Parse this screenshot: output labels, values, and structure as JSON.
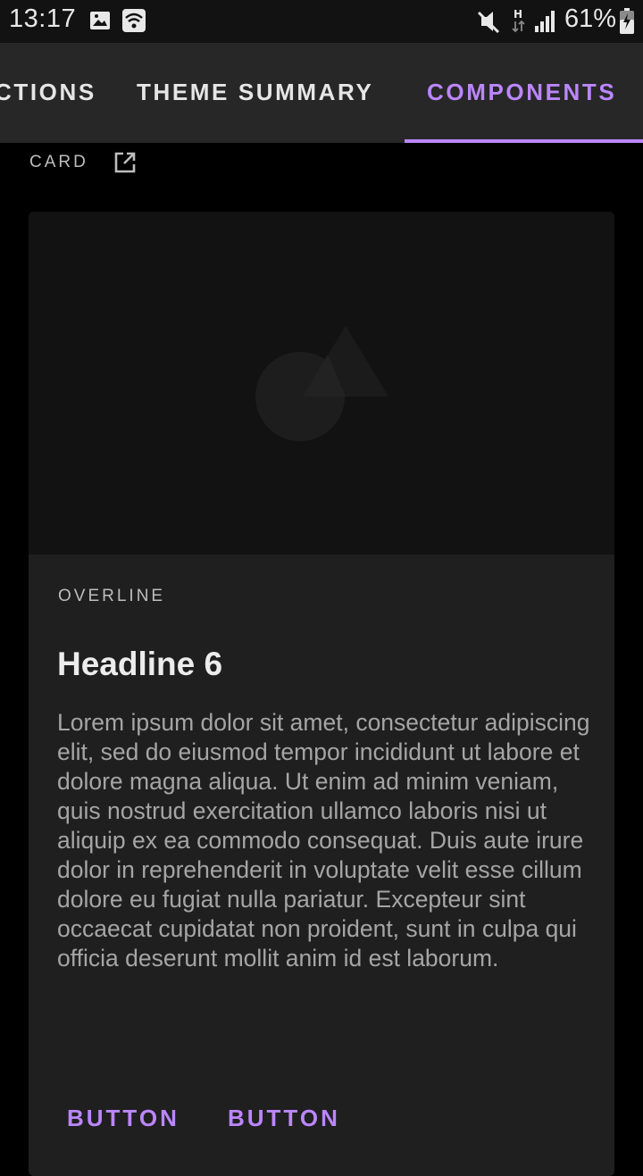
{
  "status_bar": {
    "time": "13:17",
    "battery": "61%",
    "icons": [
      "image-icon",
      "wifi-icon",
      "mute-icon",
      "network-h-icon",
      "signal-icon",
      "battery-charging-icon"
    ]
  },
  "tabs": [
    {
      "label": "CTIONS",
      "active": false
    },
    {
      "label": "THEME SUMMARY",
      "active": false
    },
    {
      "label": "COMPONENTS",
      "active": true
    }
  ],
  "accent_color": "#bb86fc",
  "section": {
    "label": "CARD",
    "link_icon": "open-in-new-icon"
  },
  "card": {
    "media_icon": "shapes-placeholder-icon",
    "overline": "OVERLINE",
    "headline": "Headline 6",
    "body": "Lorem ipsum dolor sit amet, consectetur adipiscing elit, sed do eiusmod tempor incididunt ut labore et dolore magna aliqua. Ut enim ad minim veniam, quis nostrud exercitation ullamco laboris nisi ut aliquip ex ea commodo consequat. Duis aute irure dolor in reprehenderit in voluptate velit esse cillum dolore eu fugiat nulla pariatur. Excepteur sint occaecat cupidatat non proident, sunt in culpa qui officia deserunt mollit anim id est laborum.",
    "buttons": [
      "BUTTON",
      "BUTTON"
    ]
  }
}
